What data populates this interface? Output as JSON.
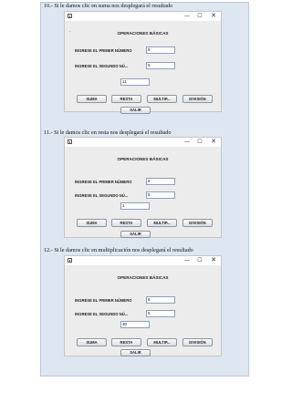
{
  "captions": [
    "10.- Si le damos clic en suma nos desplegará el resultado",
    "11.- Si le damos clic en resta nos desplegará el resultado",
    "12.- Si le damos clic en multiplicación nos desplegará el resultado"
  ],
  "window": {
    "title_icons": [
      "app-icon",
      "minimize-icon",
      "maximize-icon",
      "close-icon"
    ],
    "min_glyph": "—",
    "max_glyph": "☐",
    "close_glyph": "✕"
  },
  "form": {
    "title": "OPERACIONES BÁSICAS",
    "label_first": "INGRESE EL PRIMER NÚMERO",
    "label_second": "INGRESE EL SEGUNDO NÚ...",
    "btn_suma": "SUMA",
    "btn_resta": "RESTA",
    "btn_multip": "MULTIP...",
    "btn_division": "DIVISIÓN",
    "btn_salir": "SALIR"
  },
  "windows": [
    {
      "first": "6",
      "second": "5",
      "result": "11"
    },
    {
      "first": "6",
      "second": "5",
      "result": "1"
    },
    {
      "first": "6",
      "second": "5",
      "result": "30"
    }
  ]
}
